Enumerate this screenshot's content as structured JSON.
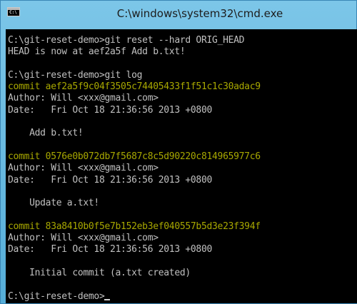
{
  "window": {
    "title": "C:\\windows\\system32\\cmd.exe",
    "icon": "console-app-icon",
    "icon_label": "C:\\"
  },
  "console": {
    "lines": [
      {
        "text": "C:\\git-reset-demo>git reset --hard ORIG_HEAD",
        "kind": "normal"
      },
      {
        "text": "HEAD is now at aef2a5f Add b.txt!",
        "kind": "normal"
      },
      {
        "text": "",
        "kind": "normal"
      },
      {
        "text": "C:\\git-reset-demo>git log",
        "kind": "normal"
      },
      {
        "text": "commit aef2a5f9c04f3505c74405433f1f51c1c30adac9",
        "kind": "commit"
      },
      {
        "text": "Author: Will <xxx@gmail.com>",
        "kind": "normal"
      },
      {
        "text": "Date:   Fri Oct 18 21:36:56 2013 +0800",
        "kind": "normal"
      },
      {
        "text": "",
        "kind": "normal"
      },
      {
        "text": "    Add b.txt!",
        "kind": "normal"
      },
      {
        "text": "",
        "kind": "normal"
      },
      {
        "text": "commit 0576e0b072db7f5687c8c5d90220c814965977c6",
        "kind": "commit"
      },
      {
        "text": "Author: Will <xxx@gmail.com>",
        "kind": "normal"
      },
      {
        "text": "Date:   Fri Oct 18 21:36:56 2013 +0800",
        "kind": "normal"
      },
      {
        "text": "",
        "kind": "normal"
      },
      {
        "text": "    Update a.txt!",
        "kind": "normal"
      },
      {
        "text": "",
        "kind": "normal"
      },
      {
        "text": "commit 83a8410b0f5e7b152eb3ef040557b5d3e23f394f",
        "kind": "commit"
      },
      {
        "text": "Author: Will <xxx@gmail.com>",
        "kind": "normal"
      },
      {
        "text": "Date:   Fri Oct 18 21:36:56 2013 +0800",
        "kind": "normal"
      },
      {
        "text": "",
        "kind": "normal"
      },
      {
        "text": "    Initial commit (a.txt created)",
        "kind": "normal"
      },
      {
        "text": "",
        "kind": "normal"
      },
      {
        "text": "C:\\git-reset-demo>",
        "kind": "prompt"
      }
    ],
    "colors": {
      "background": "#000000",
      "text": "#c0c0c0",
      "commit": "#a8a800"
    }
  }
}
